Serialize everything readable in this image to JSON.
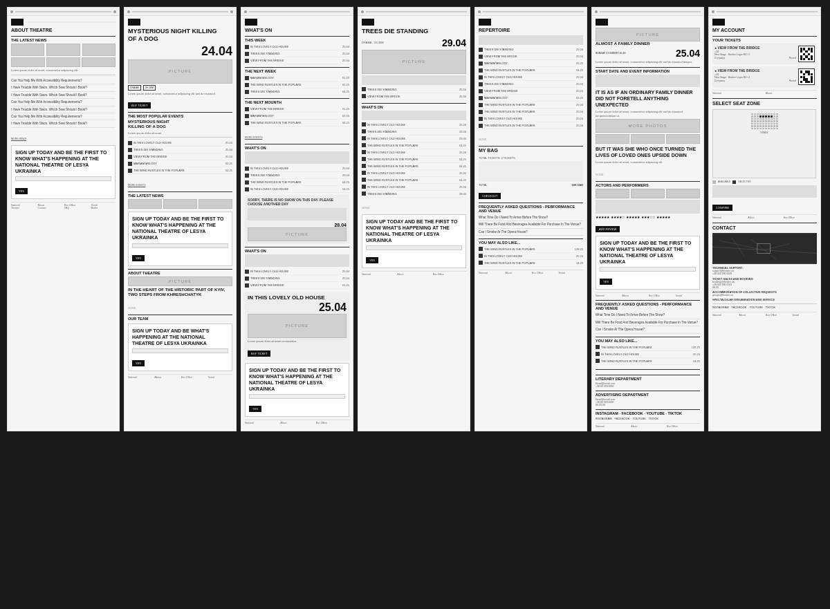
{
  "screens": [
    {
      "id": "about-theatre",
      "title": "ABOUT THEATRE",
      "width": 165,
      "type": "about"
    },
    {
      "id": "mysterious-night",
      "title": "MYSTERIOUS NIGHT KILLING OF A DOG",
      "date": "24.04",
      "width": 165,
      "type": "event-detail"
    },
    {
      "id": "whats-on",
      "title": "WHAT'S ON",
      "width": 165,
      "type": "whats-on-1"
    },
    {
      "id": "trees-die",
      "title": "TREES DIE STANDING",
      "date": "29.04",
      "width": 165,
      "type": "event-detail-2"
    },
    {
      "id": "repertoire",
      "title": "REPERTOIRE",
      "width": 165,
      "type": "repertoire"
    },
    {
      "id": "almost-family",
      "title": "ALMOST A FAMILY DINNER",
      "date": "25.04",
      "width": 165,
      "type": "family-dinner"
    },
    {
      "id": "my-account",
      "title": "MY ACCOUNT",
      "width": 165,
      "type": "account"
    }
  ],
  "screen2rows": [
    {
      "icon": true,
      "text": "IN THIS LOVELY OLD HOUSE",
      "date": "25.04"
    },
    {
      "icon": true,
      "text": "TREES DIE STANDING",
      "date": "25.04"
    },
    {
      "icon": true,
      "text": "VIEW FROM THE BRIDGE",
      "date": "25.04"
    }
  ],
  "whatsOnItems": [
    {
      "text": "MARIAM MELODY",
      "date": "01.25"
    },
    {
      "text": "THE WIND RUSTLES IN THE POPLARS",
      "date": "02.25"
    },
    {
      "text": "TREES DIE STANDING",
      "date": "04.25"
    }
  ],
  "nextWeekItems": [
    {
      "text": "MARIAM MELODY",
      "date": "01.25"
    },
    {
      "text": "THE WIND RUSTLES IN THE POPLARS",
      "date": "02.25"
    },
    {
      "text": "TREES DIE STANDING",
      "date": "04.25"
    }
  ],
  "nextMonthItems": [
    {
      "text": "VIEW FROM THE BRIDGE",
      "date": "01.25"
    },
    {
      "text": "MARIAM MELODY",
      "date": "02.25"
    },
    {
      "text": "THE WIND RUSTLES IN THE POPLARS",
      "date": "06.25"
    }
  ],
  "moreItems": [
    {
      "text": "THE WIND RUSTLES IN THE POPLARS",
      "date": "04.25"
    },
    {
      "text": "IN THIS LOVELY OLD HOUSE",
      "date": "04.25"
    },
    {
      "text": "THE WIND RUSTLES IN THE POPLARS",
      "date": "04.25"
    },
    {
      "text": "IN THIS LOVELY OLD HOUSE",
      "date": "25.04"
    },
    {
      "text": "TREES DIE STANDING",
      "date": "25.04"
    }
  ],
  "contactLabel": "CONTACT",
  "selectSeatLabel": "SELECT SEAT ZONE",
  "myAccountLabel": "MY ACCOUNT",
  "myBagLabel": "MY BAG",
  "repertoireLabel": "REPERTOIRE",
  "newsletterText": "SIGN UP TODAY AND BE THE FIRST TO KNOW WHAT'S HAPPENING AT THE NATIONAL THEATRE OF LESYA UKRAINKA",
  "aboutTheatreText": "IN THE HEART OF THE HISTORIC PART OF KYIV, TWO STEPS FROM KHRESHCHATYK",
  "familyDinnerLong": "IT IS AS IF AN ORDINARY FAMILY DINNER DID NOT FORETELL ANYTHING UNEXPECTED",
  "familyDinnerLong2": "BUT IT WAS SHE WHO ONCE TURNED THE LIVES OF LOVED ONES UPSIDE DOWN",
  "inThisLovelyOldHouse": "IN THIS LOVELY OLD HOUSE",
  "inThisLovelyDate": "25.04",
  "whatSon": "WHAT'S ON",
  "latestNews": "THE LATEST NEWS"
}
